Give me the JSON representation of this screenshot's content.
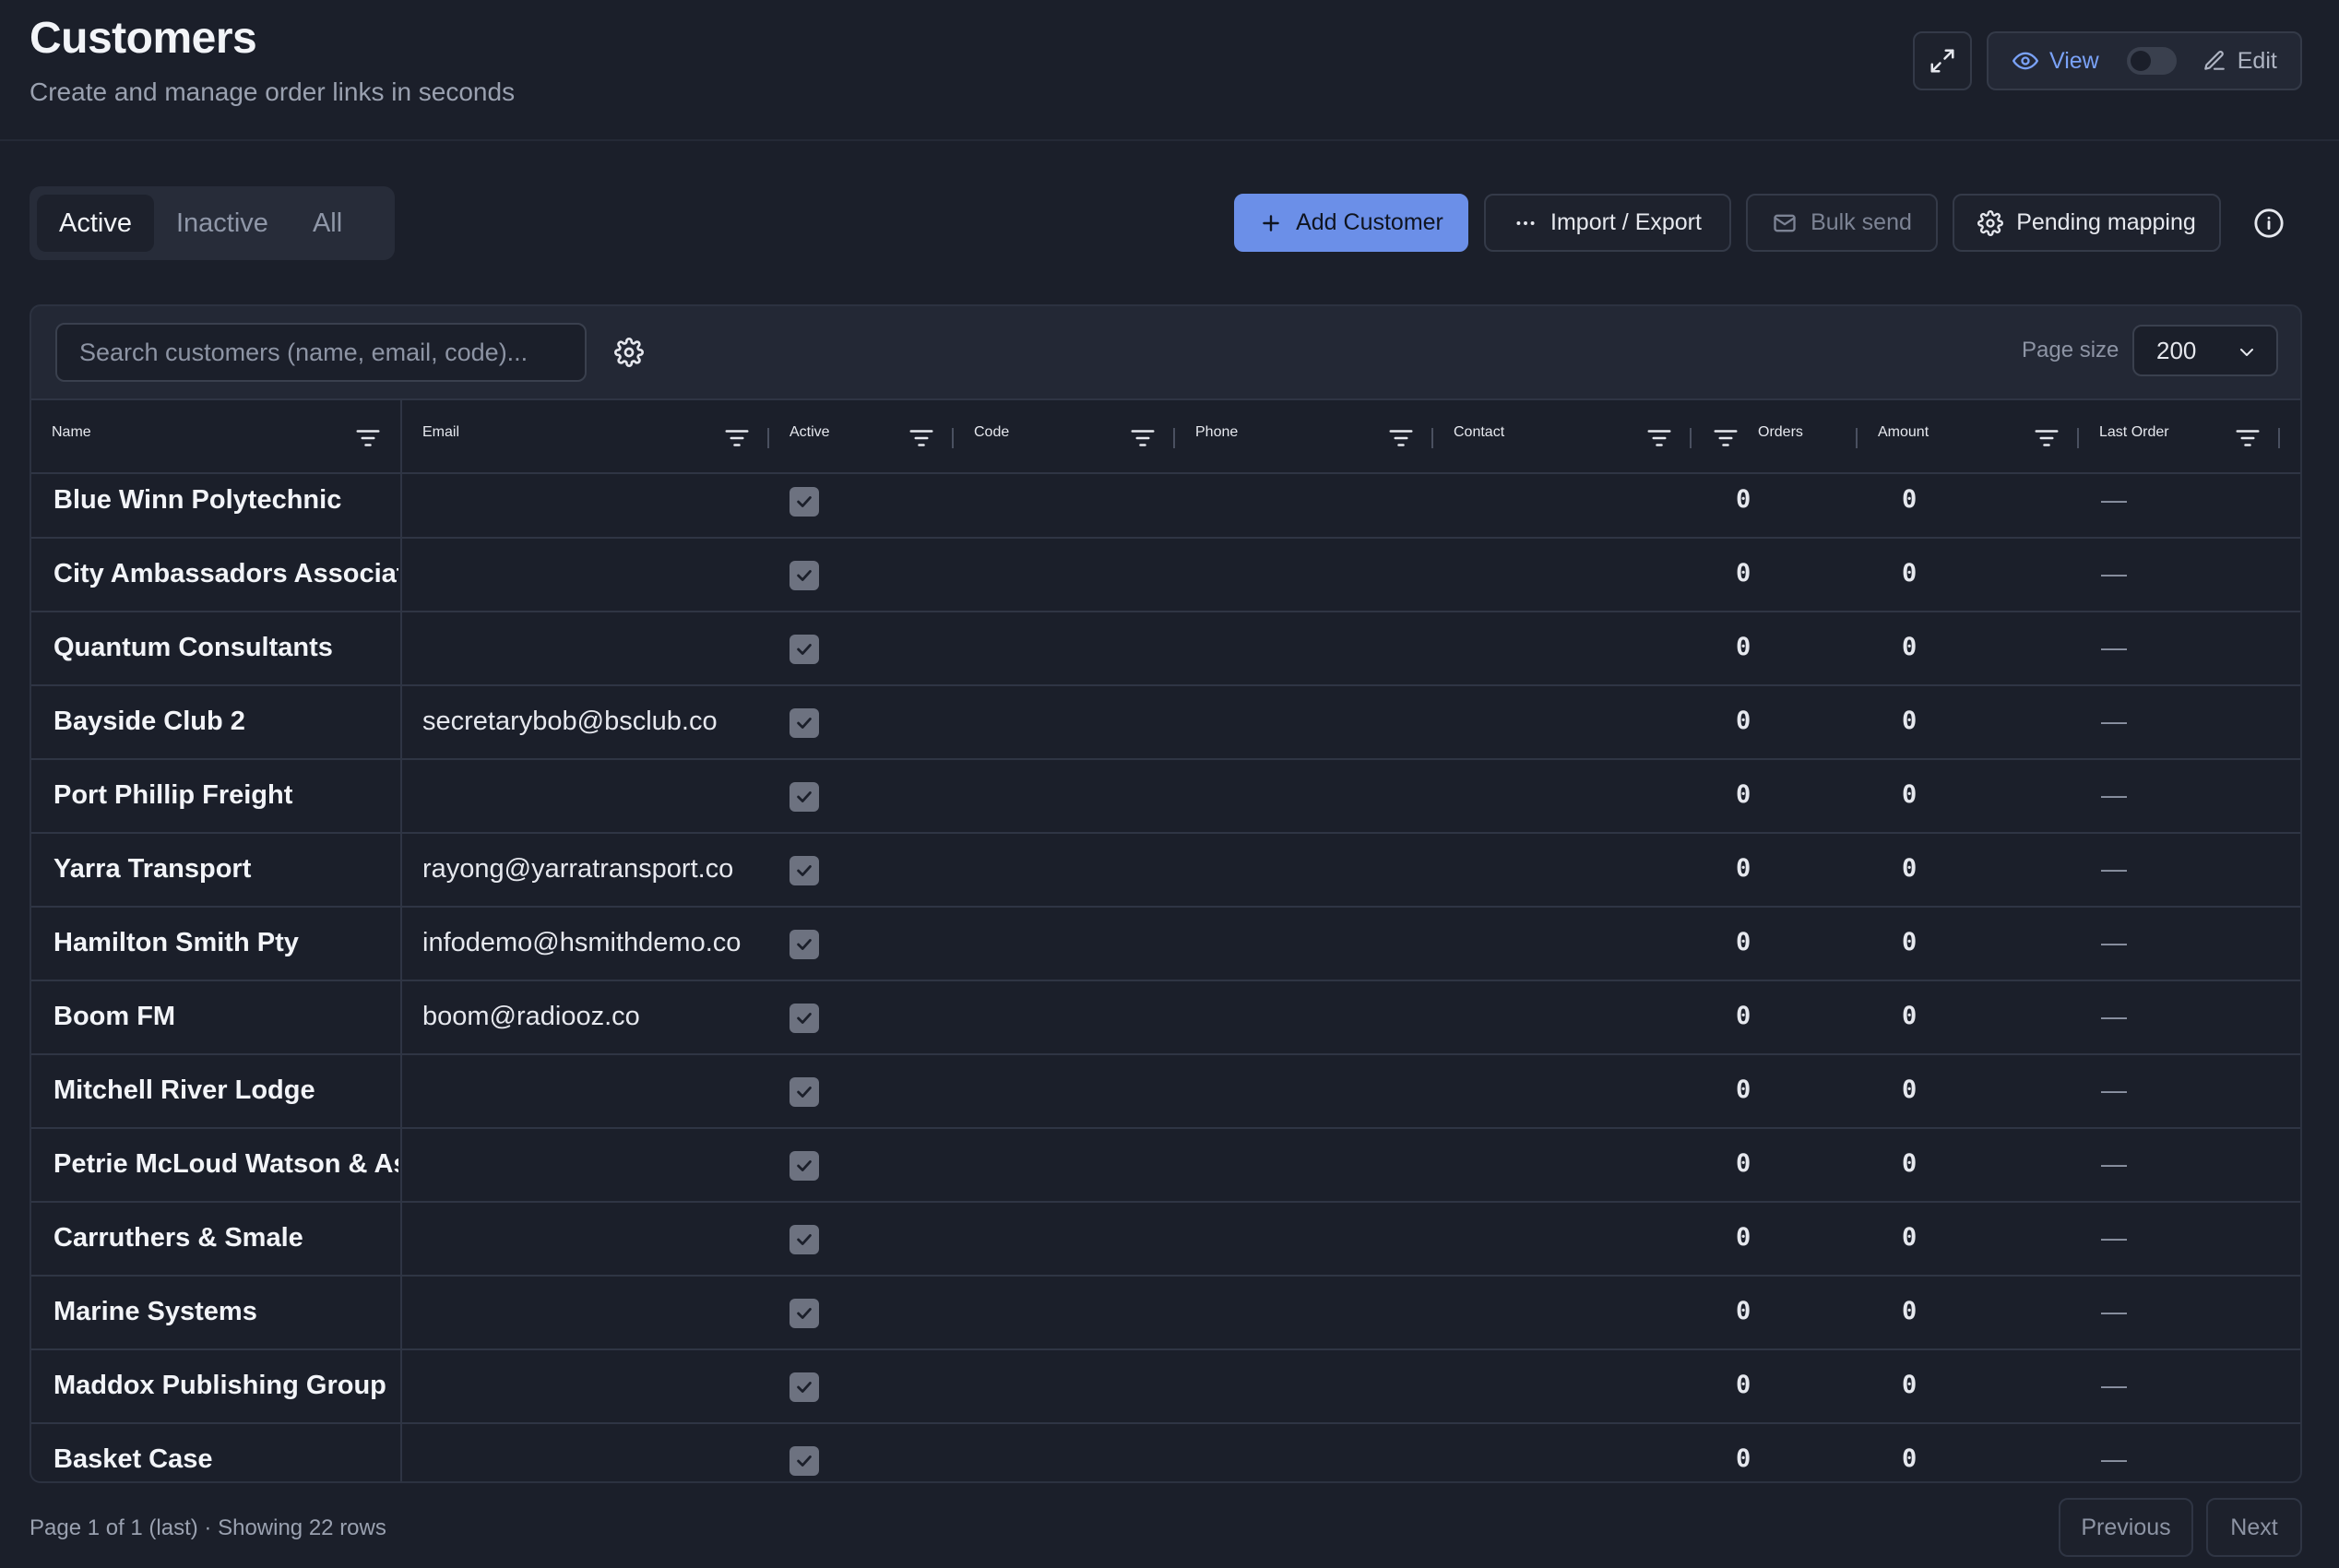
{
  "header": {
    "title": "Customers",
    "subtitle": "Create and manage order links in seconds",
    "view_label": "View",
    "edit_label": "Edit"
  },
  "tabs": [
    {
      "label": "Active",
      "active": true
    },
    {
      "label": "Inactive",
      "active": false
    },
    {
      "label": "All",
      "active": false
    }
  ],
  "toolbar": {
    "add_customer": "Add Customer",
    "import_export": "Import / Export",
    "bulk_send": "Bulk send",
    "pending_mapping": "Pending mapping"
  },
  "search": {
    "placeholder": "Search customers (name, email, code)..."
  },
  "page_size": {
    "label": "Page size",
    "value": "200"
  },
  "columns": {
    "name": "Name",
    "email": "Email",
    "active": "Active",
    "code": "Code",
    "phone": "Phone",
    "contact": "Contact",
    "orders": "Orders",
    "amount": "Amount",
    "last_order": "Last Order"
  },
  "rows": [
    {
      "name": "Blue Winn Polytechnic",
      "email": "",
      "active": true,
      "orders": "0",
      "amount": "0",
      "last_order": "—"
    },
    {
      "name": "City Ambassadors Association",
      "email": "",
      "active": true,
      "orders": "0",
      "amount": "0",
      "last_order": "—"
    },
    {
      "name": "Quantum Consultants",
      "email": "",
      "active": true,
      "orders": "0",
      "amount": "0",
      "last_order": "—"
    },
    {
      "name": "Bayside Club 2",
      "email": "secretarybob@bsclub.co",
      "active": true,
      "orders": "0",
      "amount": "0",
      "last_order": "—"
    },
    {
      "name": "Port Phillip Freight",
      "email": "",
      "active": true,
      "orders": "0",
      "amount": "0",
      "last_order": "—"
    },
    {
      "name": "Yarra Transport",
      "email": "rayong@yarratransport.co",
      "active": true,
      "orders": "0",
      "amount": "0",
      "last_order": "—"
    },
    {
      "name": "Hamilton Smith Pty",
      "email": "infodemo@hsmithdemo.co",
      "active": true,
      "orders": "0",
      "amount": "0",
      "last_order": "—"
    },
    {
      "name": "Boom FM",
      "email": "boom@radiooz.co",
      "active": true,
      "orders": "0",
      "amount": "0",
      "last_order": "—"
    },
    {
      "name": "Mitchell River Lodge",
      "email": "",
      "active": true,
      "orders": "0",
      "amount": "0",
      "last_order": "—"
    },
    {
      "name": "Petrie McLoud Watson & Associates",
      "email": "",
      "active": true,
      "orders": "0",
      "amount": "0",
      "last_order": "—"
    },
    {
      "name": "Carruthers & Smale",
      "email": "",
      "active": true,
      "orders": "0",
      "amount": "0",
      "last_order": "—"
    },
    {
      "name": "Marine Systems",
      "email": "",
      "active": true,
      "orders": "0",
      "amount": "0",
      "last_order": "—"
    },
    {
      "name": "Maddox Publishing Group",
      "email": "",
      "active": true,
      "orders": "0",
      "amount": "0",
      "last_order": "—"
    },
    {
      "name": "Basket Case",
      "email": "",
      "active": true,
      "orders": "0",
      "amount": "0",
      "last_order": "—"
    }
  ],
  "footer": {
    "status": "Page 1 of 1 (last) · Showing 22 rows",
    "previous": "Previous",
    "next": "Next"
  },
  "colors": {
    "background": "#1b1f2a",
    "accent": "#6b8fe8",
    "view_accent": "#7aa2f7"
  }
}
